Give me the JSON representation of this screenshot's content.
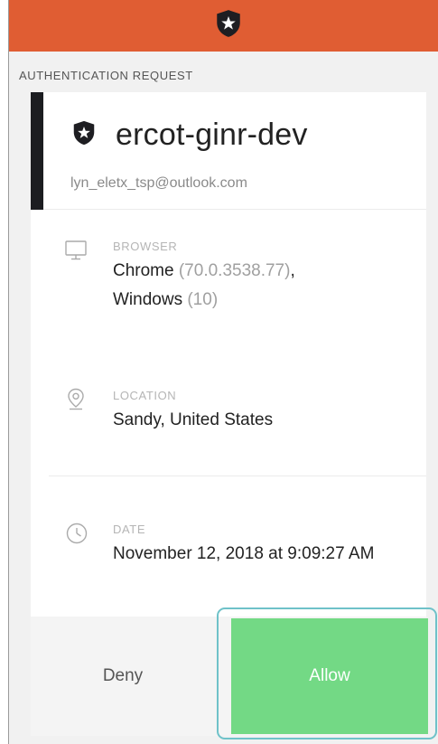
{
  "header": {
    "logo_icon": "shield-star-icon",
    "color": "#e05d33"
  },
  "section_title": "AUTHENTICATION REQUEST",
  "app": {
    "icon": "shield-star-icon",
    "name": "ercot-ginr-dev",
    "email": "lyn_eletx_tsp@outlook.com"
  },
  "browser": {
    "icon": "monitor-icon",
    "label": "BROWSER",
    "name": "Chrome",
    "version": "(70.0.3538.77)",
    "comma": ",",
    "os": "Windows",
    "os_version": "(10)"
  },
  "location": {
    "icon": "map-pin-icon",
    "label": "LOCATION",
    "value": "Sandy, United States"
  },
  "date": {
    "icon": "clock-icon",
    "label": "DATE",
    "value": "November 12, 2018 at 9:09:27 AM"
  },
  "actions": {
    "deny_label": "Deny",
    "allow_label": "Allow",
    "allow_color": "#73d985"
  }
}
